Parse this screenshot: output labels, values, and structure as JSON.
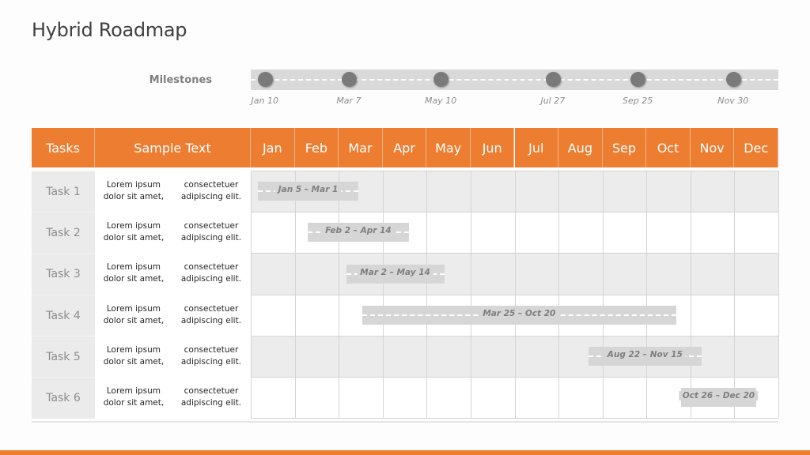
{
  "title": "Hybrid Roadmap",
  "milestones": {
    "label": "Milestones",
    "items": [
      {
        "date": "Jan 10",
        "month_pos": 0.32
      },
      {
        "date": "Mar 7",
        "month_pos": 2.23
      },
      {
        "date": "May 10",
        "month_pos": 4.32
      },
      {
        "date": "Jul 27",
        "month_pos": 6.87
      },
      {
        "date": "Sep 25",
        "month_pos": 8.8
      },
      {
        "date": "Nov 30",
        "month_pos": 10.97
      }
    ]
  },
  "table": {
    "headers": {
      "tasks": "Tasks",
      "sample_text": "Sample Text"
    },
    "months": [
      "Jan",
      "Feb",
      "Mar",
      "Apr",
      "May",
      "Jun",
      "Jul",
      "Aug",
      "Sep",
      "Oct",
      "Nov",
      "Dec"
    ],
    "rows": [
      {
        "task": "Task 1",
        "desc_line1": "Lorem ipsum dolor sit amet,",
        "desc_line2": "consectetuer adipiscing elit.",
        "bar_label": "Jan 5 – Mar 1",
        "start": 0.16,
        "end": 2.45
      },
      {
        "task": "Task 2",
        "desc_line1": "Lorem ipsum dolor sit amet,",
        "desc_line2": "consectetuer adipiscing elit.",
        "bar_label": "Feb 2 – Apr 14",
        "start": 1.29,
        "end": 3.6
      },
      {
        "task": "Task 3",
        "desc_line1": "Lorem ipsum dolor sit amet,",
        "desc_line2": "consectetuer adipiscing elit.",
        "bar_label": "Mar 2 – May 14",
        "start": 2.17,
        "end": 4.4
      },
      {
        "task": "Task 4",
        "desc_line1": "Lorem ipsum dolor sit amet,",
        "desc_line2": "consectetuer adipiscing elit.",
        "bar_label": "Mar 25 – Oct 20",
        "start": 2.53,
        "end": 9.68
      },
      {
        "task": "Task 5",
        "desc_line1": "Lorem ipsum dolor sit amet,",
        "desc_line2": "consectetuer adipiscing elit.",
        "bar_label": "Aug 22 – Nov 15",
        "start": 7.68,
        "end": 10.25
      },
      {
        "task": "Task 6",
        "desc_line1": "Lorem ipsum dolor sit amet,",
        "desc_line2": "consectetuer adipiscing elit.",
        "bar_label": "Oct 26 – Dec 20",
        "start": 9.78,
        "end": 11.5
      }
    ]
  },
  "colors": {
    "accent": "#ED7D31",
    "bar": "#D6D6D6",
    "milestone_dot": "#7A7A7A"
  }
}
